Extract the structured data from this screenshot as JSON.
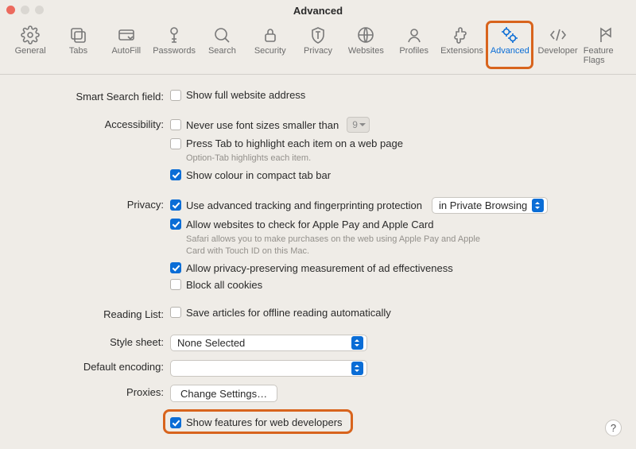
{
  "window": {
    "title": "Advanced"
  },
  "toolbar": {
    "items": [
      {
        "label": "General"
      },
      {
        "label": "Tabs"
      },
      {
        "label": "AutoFill"
      },
      {
        "label": "Passwords"
      },
      {
        "label": "Search"
      },
      {
        "label": "Security"
      },
      {
        "label": "Privacy"
      },
      {
        "label": "Websites"
      },
      {
        "label": "Profiles"
      },
      {
        "label": "Extensions"
      },
      {
        "label": "Advanced"
      },
      {
        "label": "Developer"
      },
      {
        "label": "Feature Flags"
      }
    ]
  },
  "sections": {
    "smart_search": {
      "label": "Smart Search field:",
      "show_full_url": {
        "text": "Show full website address",
        "checked": false
      }
    },
    "accessibility": {
      "label": "Accessibility:",
      "min_font": {
        "text": "Never use font sizes smaller than",
        "checked": false,
        "value": "9"
      },
      "press_tab": {
        "text": "Press Tab to highlight each item on a web page",
        "checked": false,
        "help": "Option-Tab highlights each item."
      },
      "show_colour": {
        "text": "Show colour in compact tab bar",
        "checked": true
      }
    },
    "privacy": {
      "label": "Privacy:",
      "tracking": {
        "text": "Use advanced tracking and fingerprinting protection",
        "checked": true,
        "scope": "in Private Browsing"
      },
      "apple_pay": {
        "text": "Allow websites to check for Apple Pay and Apple Card",
        "checked": true,
        "help": "Safari allows you to make purchases on the web using Apple Pay and Apple Card with Touch ID on this Mac."
      },
      "measurement": {
        "text": "Allow privacy-preserving measurement of ad effectiveness",
        "checked": true
      },
      "block_cookies": {
        "text": "Block all cookies",
        "checked": false
      }
    },
    "reading_list": {
      "label": "Reading List:",
      "offline": {
        "text": "Save articles for offline reading automatically",
        "checked": false
      }
    },
    "stylesheet": {
      "label": "Style sheet:",
      "value": "None Selected"
    },
    "encoding": {
      "label": "Default encoding:",
      "value": ""
    },
    "proxies": {
      "label": "Proxies:",
      "button": "Change Settings…"
    },
    "dev": {
      "text": "Show features for web developers",
      "checked": true
    }
  },
  "help_button": "?"
}
